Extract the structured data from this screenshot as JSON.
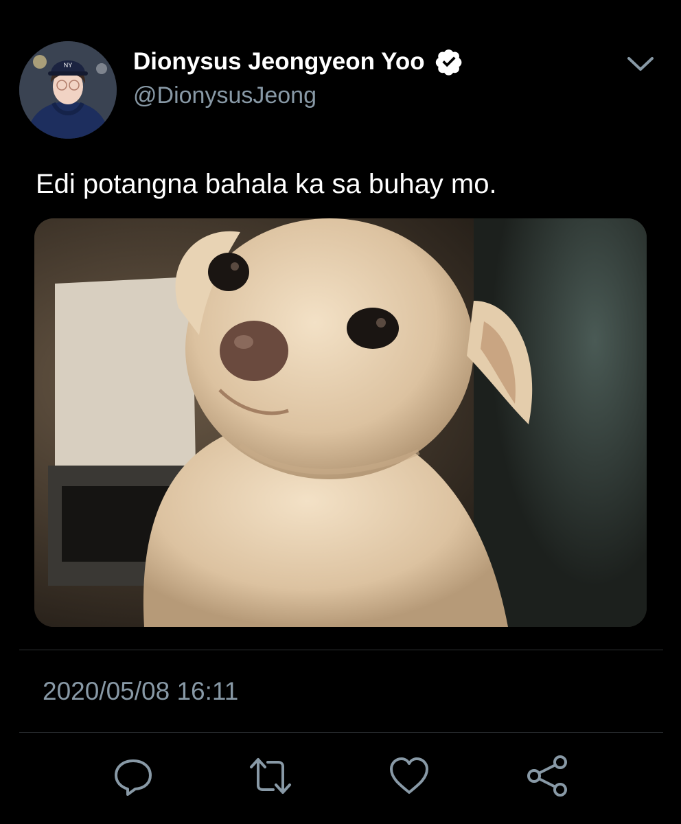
{
  "author": {
    "display_name": "Dionysus Jeongyeon Yoo",
    "handle": "@DionysusJeong",
    "verified": true,
    "avatar_icon": "avatar-photo"
  },
  "tweet": {
    "text": "Edi potangna bahala ka sa buhay mo.",
    "timestamp": "2020/05/08 16:11",
    "media_description_icon": "photo-dog"
  },
  "actions": {
    "reply_icon": "reply-icon",
    "retweet_icon": "retweet-icon",
    "like_icon": "heart-icon",
    "share_icon": "share-icon"
  },
  "colors": {
    "background": "#000000",
    "primary_text": "#ffffff",
    "secondary_text": "#8899a6",
    "divider": "#2f3336",
    "icon": "#8899a6"
  }
}
